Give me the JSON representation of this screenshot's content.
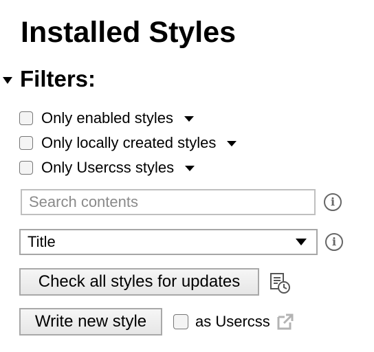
{
  "page": {
    "title": "Installed Styles"
  },
  "filters": {
    "header_label": "Filters:",
    "options": [
      {
        "label": "Only enabled styles",
        "checked": false
      },
      {
        "label": "Only locally created styles",
        "checked": false
      },
      {
        "label": "Only Usercss styles",
        "checked": false
      }
    ],
    "search": {
      "placeholder": "Search contents",
      "value": ""
    },
    "sort": {
      "selected": "Title"
    }
  },
  "actions": {
    "check_updates_label": "Check all styles for updates",
    "write_new_label": "Write new style",
    "as_usercss_label": "as Usercss",
    "as_usercss_checked": false
  },
  "icons": {
    "info": "info-icon",
    "history": "update-history-icon",
    "external": "external-link-icon",
    "collapse": "triangle-down-icon",
    "dropdown": "chevron-down-icon"
  },
  "colors": {
    "icon_gray": "#666666",
    "external_icon": "#b3b3b3",
    "border": "#a8a8a8"
  }
}
